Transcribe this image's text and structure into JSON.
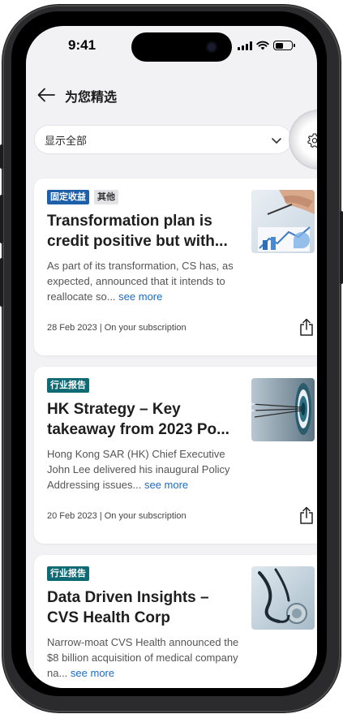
{
  "status_bar": {
    "time": "9:41"
  },
  "header": {
    "title": "为您精选"
  },
  "filter": {
    "selected": "显示全部"
  },
  "cards": [
    {
      "tags": [
        "固定收益",
        "其他"
      ],
      "title": "Transformation plan is credit positive but with...",
      "summary": "As part of its transformation, CS has, as expected, announced that it intends to reallocate so...",
      "see_more": "see more",
      "meta": "28 Feb 2023 | On your subscription"
    },
    {
      "tags": [
        "行业报告"
      ],
      "title": "HK Strategy – Key takeaway from 2023 Po...",
      "summary": "Hong Kong SAR (HK) Chief Executive John Lee delivered his inaugural Policy Addressing issues...",
      "see_more": "see more",
      "meta": "20 Feb 2023 | On your subscription"
    },
    {
      "tags": [
        "行业报告"
      ],
      "title": "Data Driven Insights – CVS Health Corp",
      "summary": "Narrow-moat CVS Health announced the $8 billion acquisition of medical company na...",
      "see_more": "see more"
    }
  ],
  "colors": {
    "tag_fixed_income": "#1d5fa8",
    "tag_industry_report": "#0e6a74",
    "link": "#1d6bc4",
    "screen_bg": "#f2f2f4"
  },
  "icons": {
    "back": "arrow-left-icon",
    "dropdown": "chevron-down-icon",
    "settings": "gear-icon",
    "share": "share-icon"
  }
}
